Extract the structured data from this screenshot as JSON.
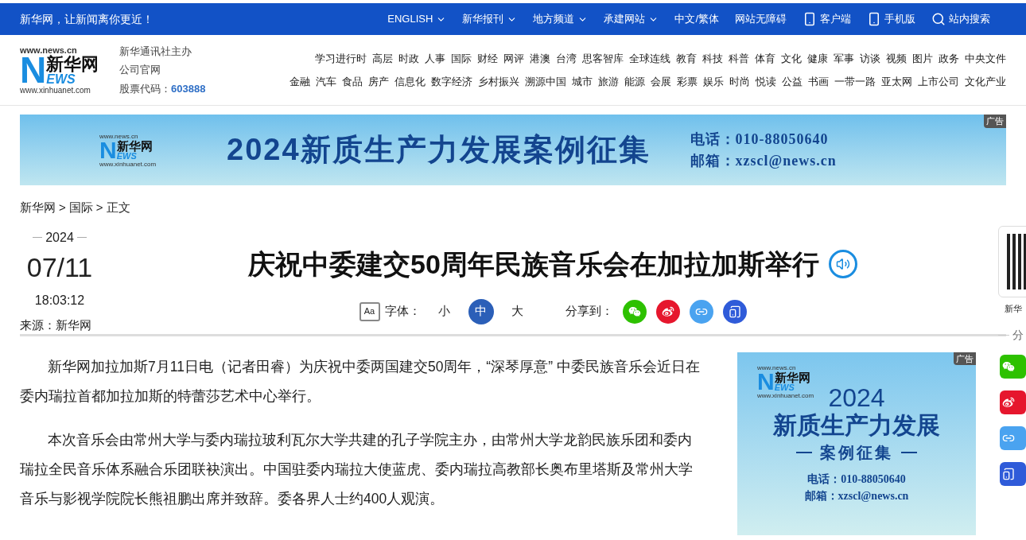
{
  "top_bar": {
    "slogan": "新华网，让新闻离你更近！",
    "items": [
      {
        "label": "ENGLISH",
        "kind": "dropdown"
      },
      {
        "label": "新华报刊",
        "kind": "dropdown"
      },
      {
        "label": "地方频道",
        "kind": "dropdown"
      },
      {
        "label": "承建网站",
        "kind": "dropdown"
      },
      {
        "label": "中文/繁体",
        "kind": "plain"
      },
      {
        "label": "网站无障碍",
        "kind": "plain"
      },
      {
        "label": "客户端",
        "kind": "app"
      },
      {
        "label": "手机版",
        "kind": "phone"
      },
      {
        "label": "站内搜索",
        "kind": "search"
      }
    ]
  },
  "header": {
    "logo": {
      "top": "www.news.cn",
      "name": "新华网",
      "initial": "N",
      "rest": "EWS",
      "bottom": "www.xinhuanet.com"
    },
    "org_lines": [
      "新华通讯社主办",
      "公司官网"
    ],
    "stock_label": "股票代码：",
    "stock_code": "603888",
    "channel_rows": [
      [
        "学习进行时",
        "高层",
        "时政",
        "人事",
        "国际",
        "财经",
        "网评",
        "港澳",
        "台湾",
        "思客智库",
        "全球连线",
        "教育",
        "科技",
        "科普",
        "体育",
        "文化",
        "健康",
        "军事",
        "访谈",
        "视频",
        "图片",
        "政务",
        "中央文件"
      ],
      [
        "金融",
        "汽车",
        "食品",
        "房产",
        "信息化",
        "数字经济",
        "乡村振兴",
        "溯源中国",
        "城市",
        "旅游",
        "能源",
        "会展",
        "彩票",
        "娱乐",
        "时尚",
        "悦读",
        "公益",
        "书画",
        "一带一路",
        "亚太网",
        "上市公司",
        "文化产业"
      ]
    ]
  },
  "banner_ad": {
    "logo": {
      "top": "www.news.cn",
      "name": "新华网",
      "initial": "N",
      "rest": "EWS",
      "bottom": "www.xinhuanet.com"
    },
    "badge": "广告",
    "title": "2024新质生产力发展案例征集",
    "phone": "电话：010-88050640",
    "email": "邮箱：xzscl@news.cn"
  },
  "breadcrumb": {
    "items": [
      "新华网",
      "国际",
      "正文"
    ],
    "separator": ">"
  },
  "article": {
    "year": "2024",
    "date": "07/11",
    "time": "18:03:12",
    "source": "来源：新华网",
    "title": "庆祝中委建交50周年民族音乐会在加拉加斯举行",
    "font_icon": "Aa",
    "font_label": "字体：",
    "font_sizes": [
      {
        "label": "小",
        "selected": false
      },
      {
        "label": "中",
        "selected": true
      },
      {
        "label": "大",
        "selected": false
      }
    ],
    "share_label": "分享到：",
    "share": [
      {
        "kind": "wechat",
        "color": "#2dc100"
      },
      {
        "kind": "weibo",
        "color": "#e6162d"
      },
      {
        "kind": "link",
        "color": "#4aa3f0"
      },
      {
        "kind": "phone",
        "color": "#2f5bd9"
      }
    ],
    "paragraphs": [
      "新华网加拉加斯7月11日电（记者田睿）为庆祝中委两国建交50周年，“深琴厚意” 中委民族音乐会近日在委内瑞拉首都加拉加斯的特蕾莎艺术中心举行。",
      "本次音乐会由常州大学与委内瑞拉玻利瓦尔大学共建的孔子学院主办，由常州大学龙韵民族乐团和委内瑞拉全民音乐体系融合乐团联袂演出。中国驻委内瑞拉大使蓝虎、委内瑞拉高教部长奥布里塔斯及常州大学音乐与影视学院院长熊祖鹏出席并致辞。委各界人士约400人观演。"
    ]
  },
  "side_ad": {
    "logo": {
      "top": "www.news.cn",
      "name": "新华网",
      "initial": "N",
      "rest": "EWS",
      "bottom": "www.xinhuanet.com"
    },
    "badge": "广告",
    "year": "2024",
    "line1": "新质生产力发展",
    "line2": "案例征集",
    "phone": "电话：010-88050640",
    "email": "邮箱：xzscl@news.cn"
  },
  "float_panel": {
    "qr_label": "新华",
    "share_label": "分",
    "share": [
      {
        "kind": "wechat",
        "color": "#2dc100"
      },
      {
        "kind": "weibo",
        "color": "#e6162d"
      },
      {
        "kind": "link",
        "color": "#4aa3f0"
      },
      {
        "kind": "phone",
        "color": "#2f5bd9"
      }
    ]
  }
}
